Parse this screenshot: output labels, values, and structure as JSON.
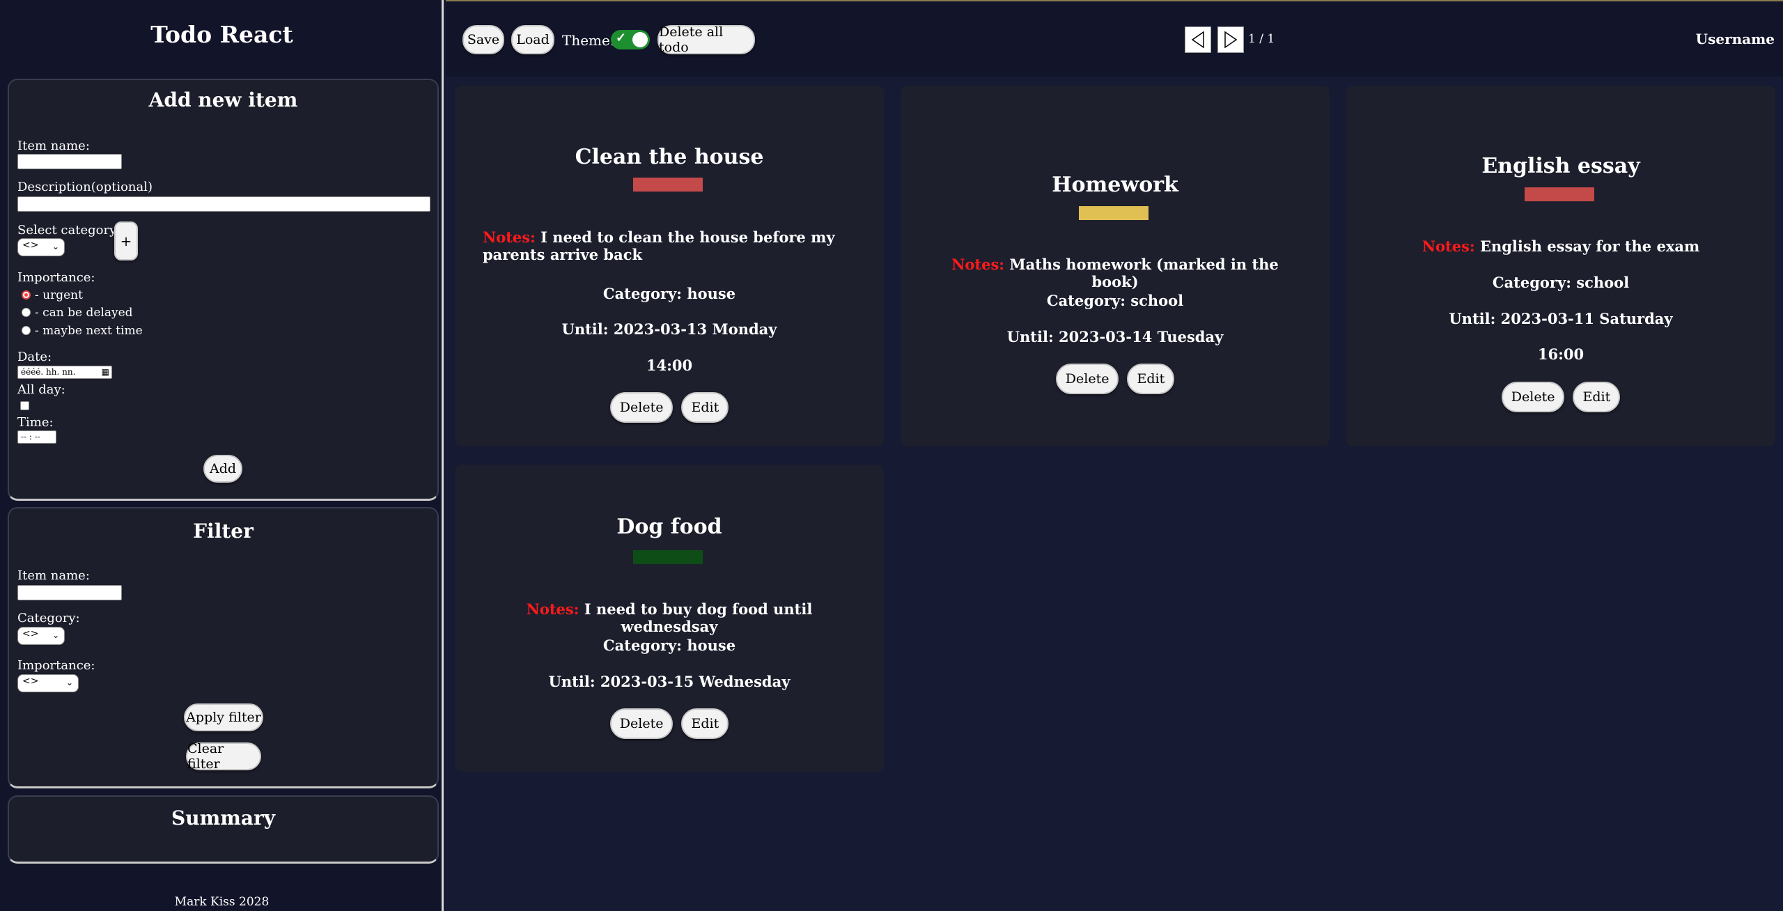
{
  "sidebar": {
    "app_title": "Todo React",
    "add_panel": {
      "title": "Add new item",
      "item_name_label": "Item name:",
      "description_label": "Description(optional)",
      "category_label": "Select category:",
      "category_value": "<>",
      "plus_label": "+",
      "importance_label": "Importance:",
      "importance_options": [
        "- urgent",
        "- can be delayed",
        "- maybe next time"
      ],
      "date_label": "Date:",
      "date_placeholder": "éééé. hh. nn.",
      "all_day_label": "All day:",
      "time_label": "Time:",
      "time_placeholder": "-- : --",
      "add_label": "Add"
    },
    "filter_panel": {
      "title": "Filter",
      "item_name_label": "Item name:",
      "category_label": "Category:",
      "category_value": "<>",
      "importance_label": "Importance:",
      "importance_value": "<>",
      "apply_label": "Apply filter",
      "clear_label": "Clear filter"
    },
    "summary_panel": {
      "title": "Summary"
    },
    "footer": "Mark Kiss 2028"
  },
  "topbar": {
    "save_label": "Save",
    "load_label": "Load",
    "theme_label": "Theme:",
    "delete_all_label": "Delete all todo",
    "page_indicator": "1 / 1",
    "username": "Username"
  },
  "cards": [
    {
      "title": "Clean the house",
      "importance_color": "#c44a4a",
      "notes_label": "Notes:",
      "notes": "I need to clean the house before my parents arrive back",
      "category": "Category: house",
      "until": "Until: 2023-03-13 Monday",
      "time": "14:00",
      "delete_label": "Delete",
      "edit_label": "Edit"
    },
    {
      "title": "Homework",
      "importance_color": "#e0c053",
      "notes_label": "Notes:",
      "notes": "Maths homework (marked in the book)",
      "category": "Category: school",
      "until": "Until: 2023-03-14 Tuesday",
      "delete_label": "Delete",
      "edit_label": "Edit"
    },
    {
      "title": "English essay",
      "importance_color": "#c44a4a",
      "notes_label": "Notes:",
      "notes": "English essay for the exam",
      "category": "Category: school",
      "until": "Until: 2023-03-11 Saturday",
      "time": "16:00",
      "delete_label": "Delete",
      "edit_label": "Edit"
    },
    {
      "title": "Dog food",
      "importance_color": "#0f4d16",
      "notes_label": "Notes:",
      "notes": "I need to buy dog food until wednesdsay",
      "category": "Category: house",
      "until": "Until: 2023-03-15 Wednesday",
      "delete_label": "Delete",
      "edit_label": "Edit"
    }
  ],
  "colors": {
    "background": "#161a33",
    "header": "#12152a",
    "card": "#1d1f2d",
    "notes_label": "#ff1a1a",
    "theme_toggle": "#1e8f2e"
  }
}
